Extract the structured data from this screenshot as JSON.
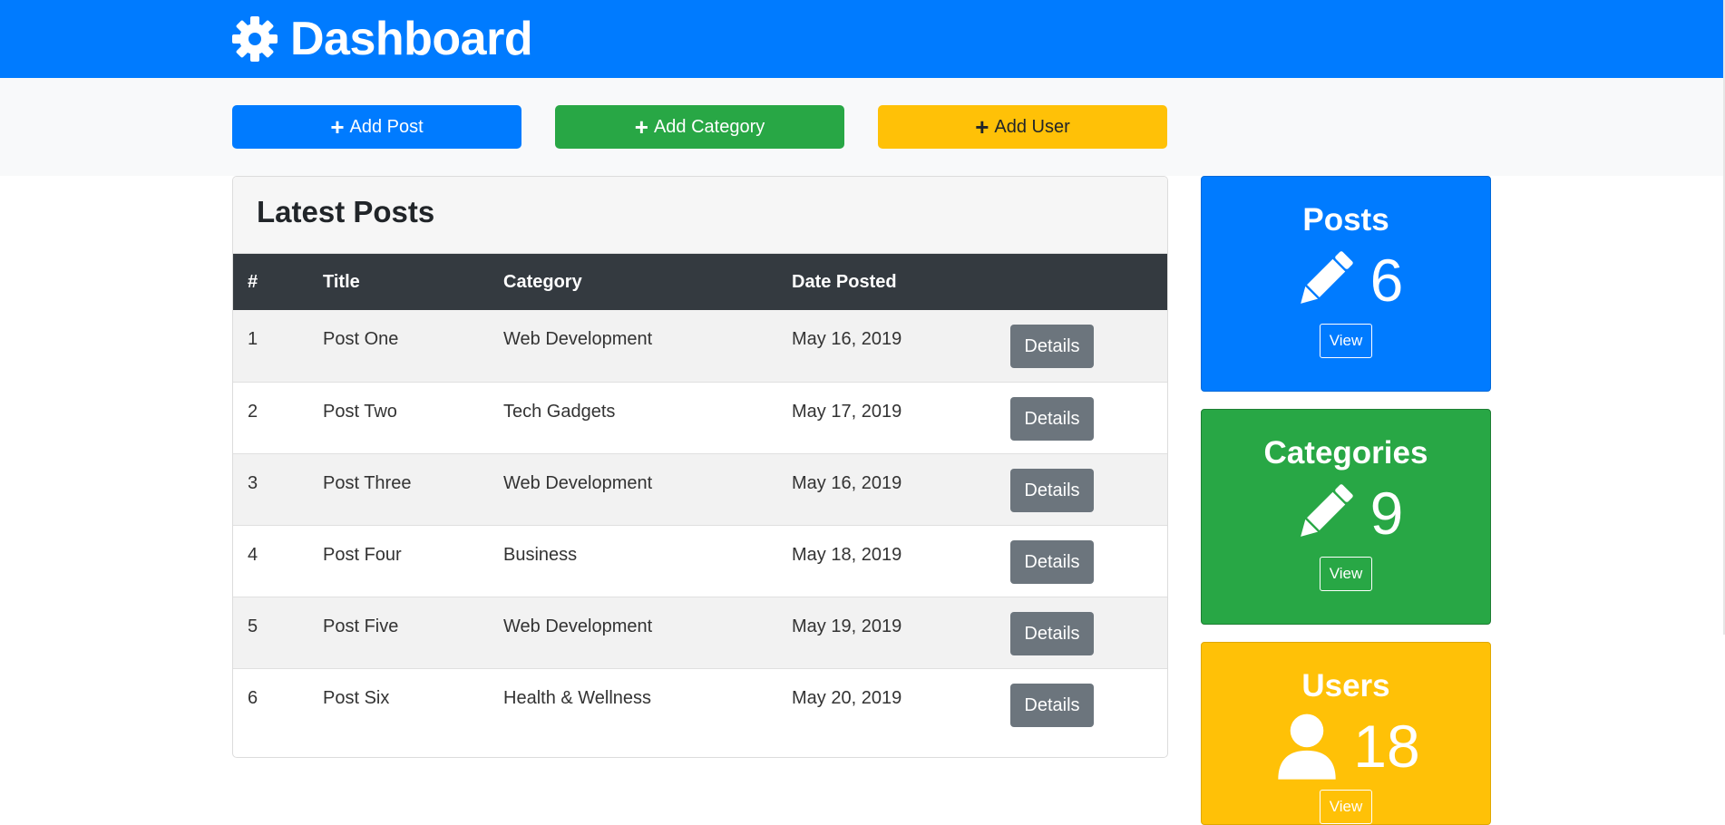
{
  "header": {
    "title": "Dashboard",
    "icon": "gear-icon",
    "color": "#007bff"
  },
  "actions": [
    {
      "label": "Add Post",
      "icon": "plus-icon",
      "color": "#007bff"
    },
    {
      "label": "Add Category",
      "icon": "plus-icon",
      "color": "#28a745"
    },
    {
      "label": "Add User",
      "icon": "plus-icon",
      "color": "#ffc107"
    }
  ],
  "latest_posts": {
    "title": "Latest Posts",
    "columns": [
      "#",
      "Title",
      "Category",
      "Date Posted",
      ""
    ],
    "rows": [
      {
        "num": "1",
        "title": "Post One",
        "category": "Web Development",
        "date": "May 16, 2019",
        "action": "Details"
      },
      {
        "num": "2",
        "title": "Post Two",
        "category": "Tech Gadgets",
        "date": "May 17, 2019",
        "action": "Details"
      },
      {
        "num": "3",
        "title": "Post Three",
        "category": "Web Development",
        "date": "May 16, 2019",
        "action": "Details"
      },
      {
        "num": "4",
        "title": "Post Four",
        "category": "Business",
        "date": "May 18, 2019",
        "action": "Details"
      },
      {
        "num": "5",
        "title": "Post Five",
        "category": "Web Development",
        "date": "May 19, 2019",
        "action": "Details"
      },
      {
        "num": "6",
        "title": "Post Six",
        "category": "Health & Wellness",
        "date": "May 20, 2019",
        "action": "Details"
      }
    ]
  },
  "stats": [
    {
      "title": "Posts",
      "count": "6",
      "icon": "pencil-icon",
      "button": "View",
      "color": "#007bff"
    },
    {
      "title": "Categories",
      "count": "9",
      "icon": "pencil-icon",
      "button": "View",
      "color": "#28a745"
    },
    {
      "title": "Users",
      "count": "18",
      "icon": "user-icon",
      "button": "View",
      "color": "#ffc107"
    }
  ]
}
